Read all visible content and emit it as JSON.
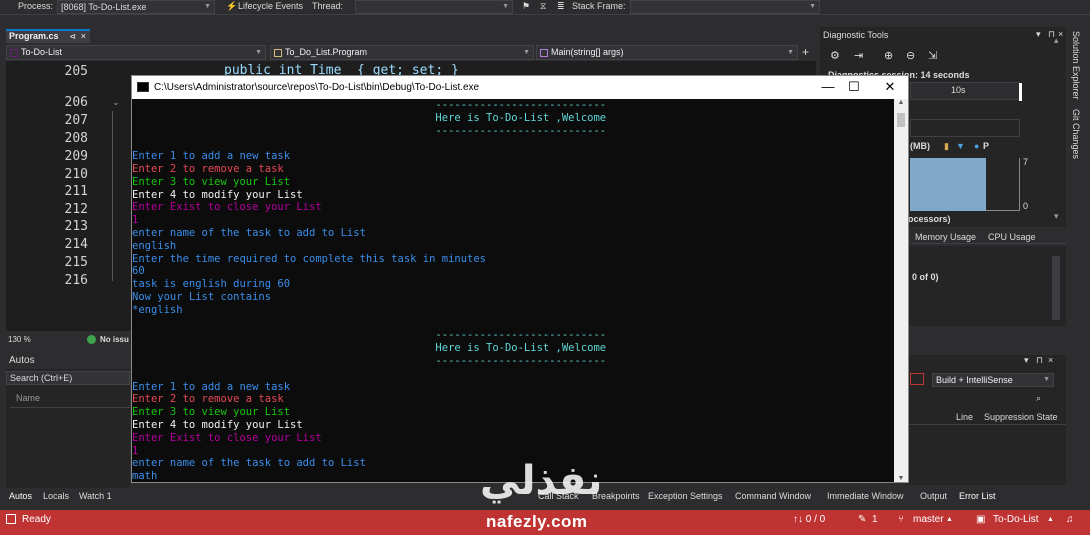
{
  "debug_toolbar": {
    "process_label": "Process:",
    "process_value": "[8068] To-Do-List.exe",
    "lifecycle_label": "Lifecycle Events",
    "thread_label": "Thread:",
    "stack_frame_label": "Stack Frame:"
  },
  "document_tab": {
    "title": "Program.cs",
    "pin": "⊲",
    "close": "×"
  },
  "nav_bar": {
    "project": "To-Do-List",
    "class": "To_Do_List.Program",
    "member": "Main(string[] args)"
  },
  "editor": {
    "line_numbers": [
      "205",
      "206",
      "207",
      "208",
      "209",
      "210",
      "211",
      "212",
      "213",
      "214",
      "215",
      "216"
    ],
    "top_code": "public int Time  { get; set; }",
    "zoom": "130 %",
    "issues": "No issu"
  },
  "autos_pane": {
    "title": "Autos",
    "search_placeholder": "Search (Ctrl+E)",
    "column_name": "Name"
  },
  "diagnostic_tools": {
    "title": "Diagnostic Tools",
    "session_text": "Diagnostics session: 14 seconds",
    "timeline_label": "10s",
    "memory_label": "(MB)",
    "flag_label": "P",
    "value_max": "7",
    "value_min": "0",
    "processors_label": "ocessors)",
    "tab_memory": "Memory Usage",
    "tab_cpu": "CPU Usage",
    "of_label": "0 of 0)"
  },
  "error_pane": {
    "build_filter": "Build + IntelliSense",
    "col_line": "Line",
    "col_suppression": "Suppression State"
  },
  "right_sidebar": {
    "solution_explorer": "Solution Explorer",
    "git_changes": "Git Changes"
  },
  "console": {
    "title": "C:\\Users\\Administrator\\source\\repos\\To-Do-List\\bin\\Debug\\To-Do-List.exe",
    "minimize": "—",
    "maximize": "☐",
    "close": "✕",
    "lines": [
      {
        "text": "                                                ---------------------------",
        "color": "cyan"
      },
      {
        "text": "                                                Here is To-Do-List ,Welcome",
        "color": "cyan"
      },
      {
        "text": "                                                ---------------------------",
        "color": "cyan"
      },
      {
        "text": "",
        "color": "gray"
      },
      {
        "text": "Enter 1 to add a new task",
        "color": "blue"
      },
      {
        "text": "Enter 2 to remove a task",
        "color": "red"
      },
      {
        "text": "Enter 3 to view your List",
        "color": "green"
      },
      {
        "text": "Enter 4 to modify your List",
        "color": "white"
      },
      {
        "text": "Enter Exist to close your List",
        "color": "magenta"
      },
      {
        "text": "1",
        "color": "magenta"
      },
      {
        "text": "enter name of the task to add to List",
        "color": "blue"
      },
      {
        "text": "english",
        "color": "blue"
      },
      {
        "text": "Enter the time required to complete this task in minutes",
        "color": "blue"
      },
      {
        "text": "60",
        "color": "blue"
      },
      {
        "text": "task is english during 60",
        "color": "blue"
      },
      {
        "text": "Now your List contains",
        "color": "blue"
      },
      {
        "text": "*english",
        "color": "blue"
      },
      {
        "text": "",
        "color": "gray"
      },
      {
        "text": "                                                ---------------------------",
        "color": "cyan"
      },
      {
        "text": "                                                Here is To-Do-List ,Welcome",
        "color": "cyan"
      },
      {
        "text": "                                                ---------------------------",
        "color": "cyan"
      },
      {
        "text": "",
        "color": "gray"
      },
      {
        "text": "Enter 1 to add a new task",
        "color": "blue"
      },
      {
        "text": "Enter 2 to remove a task",
        "color": "red"
      },
      {
        "text": "Enter 3 to view your List",
        "color": "green"
      },
      {
        "text": "Enter 4 to modify your List",
        "color": "white"
      },
      {
        "text": "Enter Exist to close your List",
        "color": "magenta"
      },
      {
        "text": "1",
        "color": "magenta"
      },
      {
        "text": "enter name of the task to add to List",
        "color": "blue"
      },
      {
        "text": "math",
        "color": "blue"
      },
      {
        "text": "Enter the time required to complete this task in minutes",
        "color": "blue"
      },
      {
        "text": "_",
        "color": "white"
      }
    ]
  },
  "bottom_tabs": {
    "left": [
      "Autos",
      "Locals",
      "Watch 1"
    ],
    "right": [
      "Call Stack",
      "Breakpoints",
      "Exception Settings",
      "Command Window",
      "Immediate Window",
      "Output",
      "Error List"
    ]
  },
  "status_bar": {
    "ready": "Ready",
    "arrows": "↑↓ 0 / 0",
    "edits": "1",
    "branch": "master",
    "project": "To-Do-List"
  },
  "watermark": {
    "arabic": "نفذلي",
    "latin": "nafezly.com"
  },
  "colors": {
    "status_bar": "#c03333",
    "console_bg": "#0c0c0c",
    "accent": "#007acc"
  }
}
